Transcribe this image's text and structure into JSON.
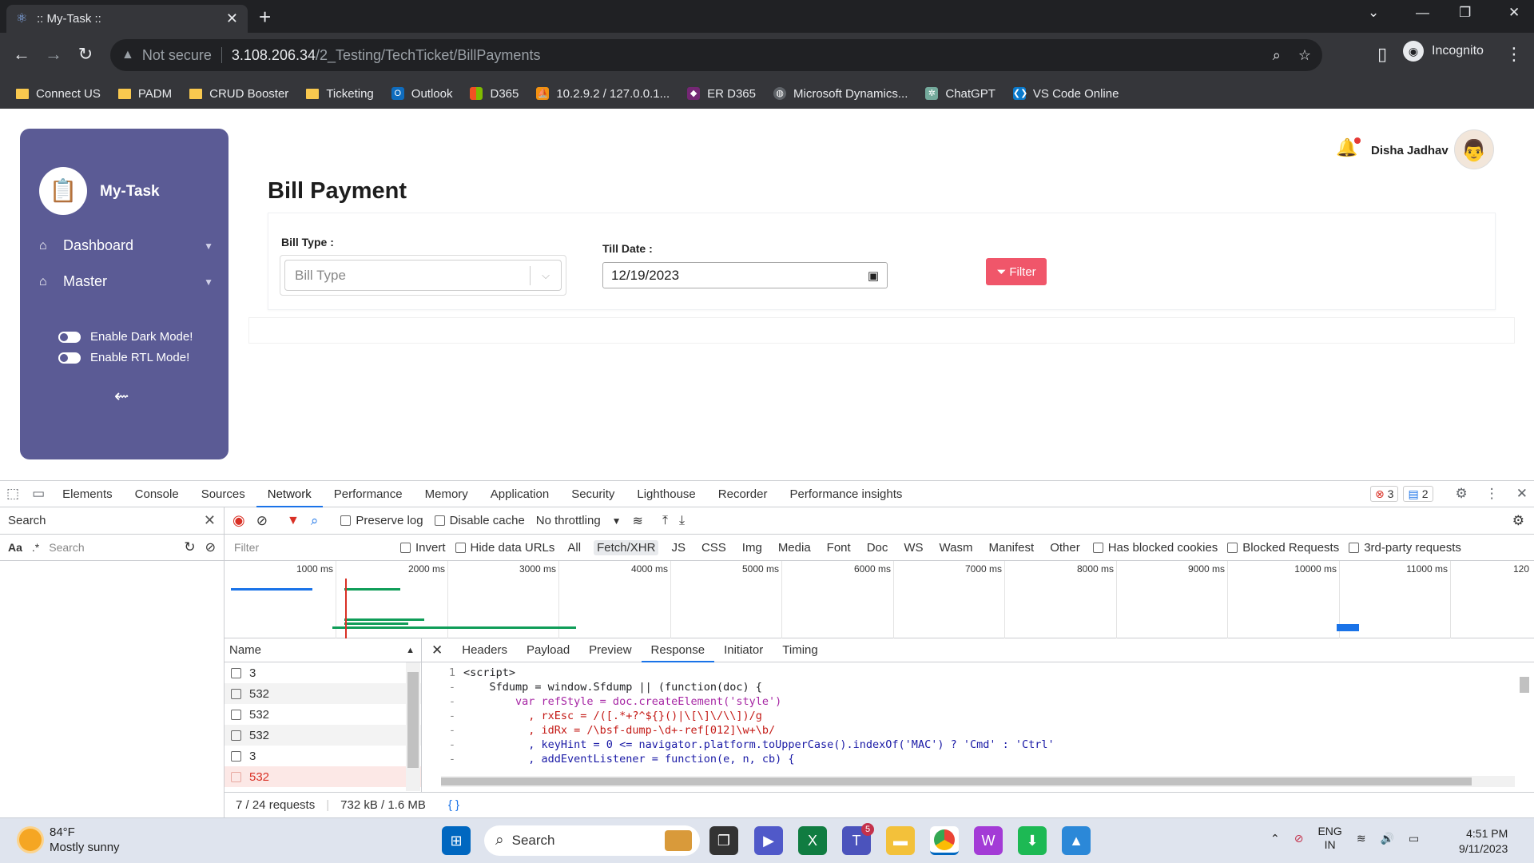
{
  "browser": {
    "tab_title": ":: My-Task ::",
    "url_warning": "Not secure",
    "url_host": "3.108.206.34",
    "url_path": "/2_Testing/TechTicket/BillPayments",
    "profile": "Incognito"
  },
  "bookmarks": [
    {
      "label": "Connect US",
      "icon": "folder-icon"
    },
    {
      "label": "PADM",
      "icon": "folder-icon"
    },
    {
      "label": "CRUD Booster",
      "icon": "folder-icon"
    },
    {
      "label": "Ticketing",
      "icon": "folder-icon"
    },
    {
      "label": "Outlook",
      "icon": "outlook-icon"
    },
    {
      "label": "D365",
      "icon": "microsoft-icon"
    },
    {
      "label": "10.2.9.2 / 127.0.0.1...",
      "icon": "phpmyadmin-icon"
    },
    {
      "label": "ER D365",
      "icon": "power-apps-icon"
    },
    {
      "label": "Microsoft Dynamics...",
      "icon": "globe-icon"
    },
    {
      "label": "ChatGPT",
      "icon": "chatgpt-icon"
    },
    {
      "label": "VS Code Online",
      "icon": "vscode-icon"
    }
  ],
  "sidebar": {
    "brand": "My-Task",
    "items": [
      {
        "label": "Dashboard"
      },
      {
        "label": "Master"
      }
    ],
    "toggles": [
      {
        "label": "Enable Dark Mode!"
      },
      {
        "label": "Enable RTL Mode!"
      }
    ]
  },
  "header": {
    "username": "Disha Jadhav"
  },
  "page": {
    "title": "Bill Payment",
    "bill_type_label": "Bill Type :",
    "bill_type_placeholder": "Bill Type",
    "till_date_label": "Till Date :",
    "till_date_value": "12/19/2023",
    "filter_label": "Filter"
  },
  "devtools": {
    "tabs": [
      "Elements",
      "Console",
      "Sources",
      "Network",
      "Performance",
      "Memory",
      "Application",
      "Security",
      "Lighthouse",
      "Recorder",
      "Performance insights"
    ],
    "active_tab": "Network",
    "error_count": "3",
    "message_count": "2",
    "search_panel_title": "Search",
    "search_case_label": "Aa",
    "search_regex_label": ".*",
    "search_placeholder": "Search",
    "toolbar": {
      "preserve_log": "Preserve log",
      "disable_cache": "Disable cache",
      "throttling": "No throttling"
    },
    "filter": {
      "placeholder": "Filter",
      "invert": "Invert",
      "hide_data_urls": "Hide data URLs",
      "types": [
        "All",
        "Fetch/XHR",
        "JS",
        "CSS",
        "Img",
        "Media",
        "Font",
        "Doc",
        "WS",
        "Wasm",
        "Manifest",
        "Other"
      ],
      "active_type": "Fetch/XHR",
      "has_blocked_cookies": "Has blocked cookies",
      "blocked_requests": "Blocked Requests",
      "third_party": "3rd-party requests"
    },
    "timeline_ticks": [
      "1000 ms",
      "2000 ms",
      "3000 ms",
      "4000 ms",
      "5000 ms",
      "6000 ms",
      "7000 ms",
      "8000 ms",
      "9000 ms",
      "10000 ms",
      "11000 ms",
      "120"
    ],
    "name_header": "Name",
    "requests": [
      {
        "name": "3",
        "error": false
      },
      {
        "name": "532",
        "error": false
      },
      {
        "name": "532",
        "error": false
      },
      {
        "name": "532",
        "error": false
      },
      {
        "name": "3",
        "error": false
      },
      {
        "name": "532",
        "error": true
      }
    ],
    "detail_tabs": [
      "Headers",
      "Payload",
      "Preview",
      "Response",
      "Initiator",
      "Timing"
    ],
    "active_detail_tab": "Response",
    "code_lines": [
      {
        "n": "1",
        "text": "<script>"
      },
      {
        "n": "-",
        "text": "    Sfdump = window.Sfdump || (function(doc) {"
      },
      {
        "n": "-",
        "text": "        var refStyle = doc.createElement('style')"
      },
      {
        "n": "-",
        "text": "          , rxEsc = /([.*+?^${}()|\\[\\]\\/\\\\])/g"
      },
      {
        "n": "-",
        "text": "          , idRx = /\\bsf-dump-\\d+-ref[012]\\w+\\b/"
      },
      {
        "n": "-",
        "text": "          , keyHint = 0 <= navigator.platform.toUpperCase().indexOf('MAC') ? 'Cmd' : 'Ctrl'"
      },
      {
        "n": "-",
        "text": "          , addEventListener = function(e, n, cb) {"
      }
    ],
    "status": {
      "requests": "7 / 24 requests",
      "size": "732 kB / 1.6 MB",
      "pretty_print": "{ }"
    }
  },
  "taskbar": {
    "temperature": "84°F",
    "weather": "Mostly sunny",
    "search": "Search",
    "teams_badge": "5",
    "lang": "ENG",
    "region": "IN",
    "time": "4:51 PM",
    "date": "9/11/2023"
  }
}
